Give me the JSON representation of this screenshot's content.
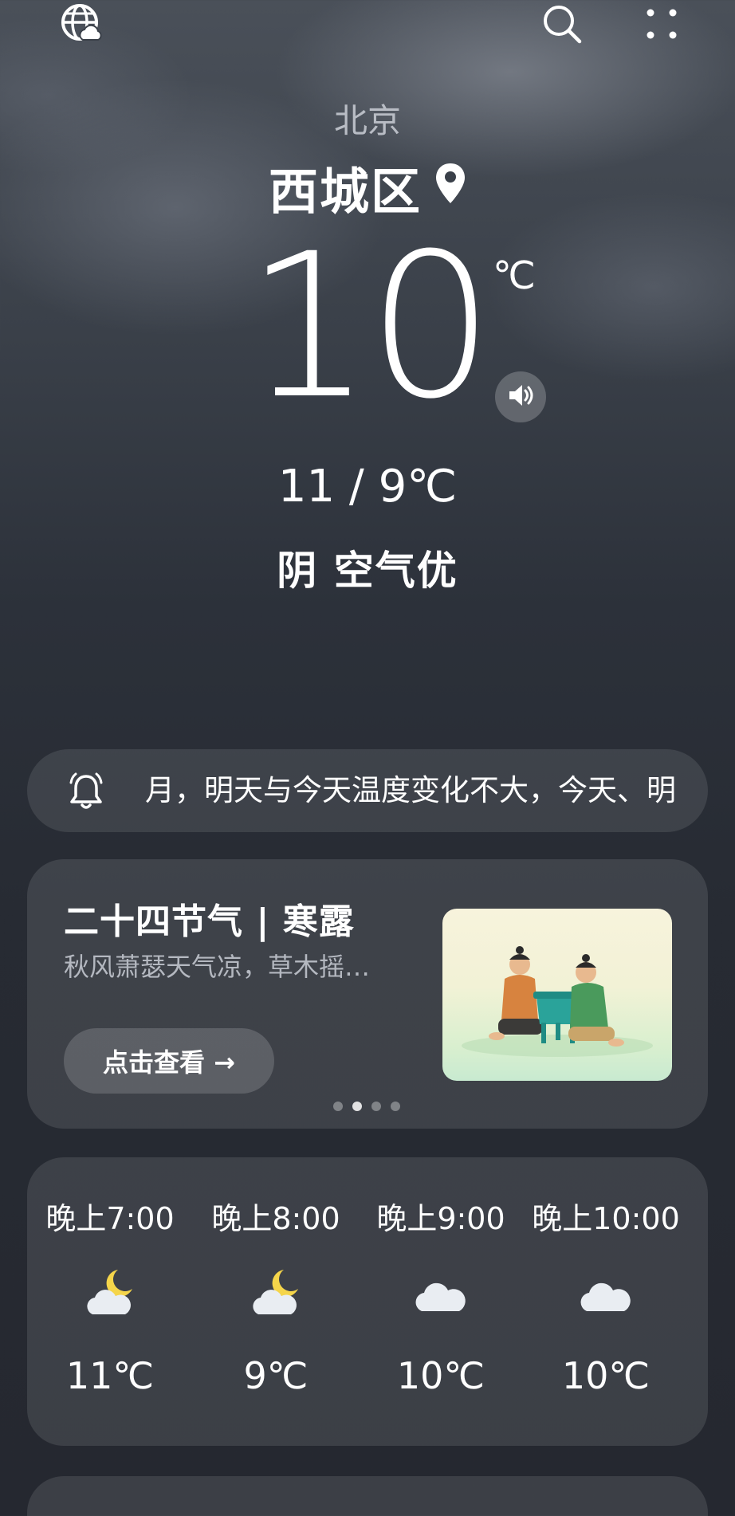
{
  "header": {
    "city": "北京",
    "district": "西城区",
    "icons": [
      "globe-cloud-icon",
      "search-icon",
      "more-icon",
      "location-pin-icon"
    ]
  },
  "current": {
    "temperature": "10",
    "unit": "℃",
    "range": "11 / 9℃",
    "condition": "阴  空气优"
  },
  "alert": {
    "text": "月，明天与今天温度变化不大，今天、明"
  },
  "solar_term": {
    "title": "二十四节气 | 寒露",
    "description": "秋风萧瑟天气凉，草木摇…",
    "button_label": "点击查看 →",
    "pages": 4,
    "active_page": 2
  },
  "hourly": [
    {
      "time": "晚上7:00",
      "icon": "moon-cloud-icon",
      "temp": "11℃"
    },
    {
      "time": "晚上8:00",
      "icon": "moon-cloud-icon",
      "temp": "9℃"
    },
    {
      "time": "晚上9:00",
      "icon": "cloud-icon",
      "temp": "10℃"
    },
    {
      "time": "晚上10:00",
      "icon": "cloud-icon",
      "temp": "10℃"
    }
  ],
  "colors": {
    "background_top": "#4a5059",
    "background_bottom": "#252830",
    "card": "rgba(255,255,255,0.11)",
    "moon": "#f5d54a"
  }
}
